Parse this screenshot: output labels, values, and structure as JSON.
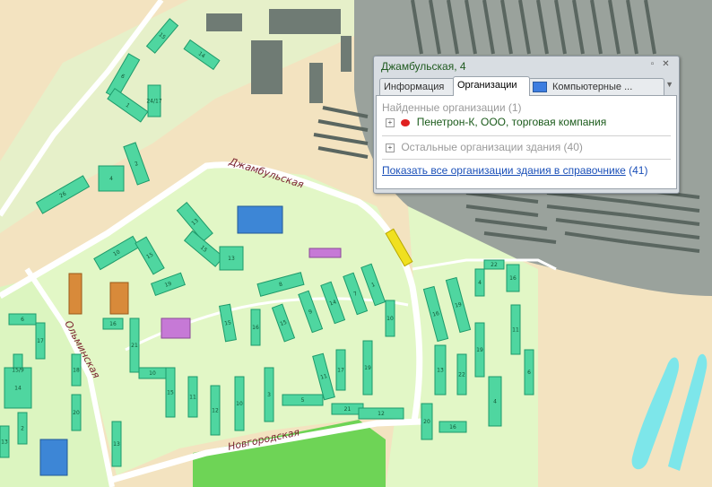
{
  "map": {
    "streets": [
      {
        "id": "dzhambul",
        "label": "Джамбульская"
      },
      {
        "id": "olminskogo",
        "label": "Ольминская"
      },
      {
        "id": "novgorod",
        "label": "Новгородская"
      }
    ],
    "building_numbers": [
      "15",
      "14",
      "6",
      "1",
      "2",
      "26",
      "4",
      "24/17",
      "10",
      "15",
      "13",
      "15",
      "13",
      "19",
      "16",
      "21",
      "10",
      "18",
      "20",
      "13",
      "17",
      "15/9",
      "6",
      "14",
      "2",
      "13",
      "15",
      "11",
      "12",
      "10",
      "3",
      "5",
      "11",
      "17",
      "19",
      "21",
      "12",
      "15",
      "16",
      "15",
      "9",
      "14",
      "7",
      "1",
      "10",
      "8",
      "16",
      "19",
      "13",
      "22",
      "19",
      "4",
      "11",
      "6",
      "16",
      "20",
      "22",
      "16",
      "4",
      "24"
    ]
  },
  "popup": {
    "title": "Джамбульская, 4",
    "tabs": [
      "Информация",
      "Организации",
      "Компьютерные ..."
    ],
    "active_tab": "Организации",
    "found_header": "Найденные организации (1)",
    "found_org": "Пенетрон-К, ООО, торговая компания",
    "other_header": "Остальные организации здания (40)",
    "show_all_link": "Показать все организации здания в справочнике",
    "show_all_count": "(41)"
  },
  "colors": {
    "ground": "#f3e3c0",
    "park": "#d6f2b8",
    "park_dark": "#7ed35c",
    "building": "#4fd6a0",
    "building_side": "#1e9a6a",
    "industrial": "#7f8f7f",
    "highlight": "#f0e020",
    "water": "#7de6ea"
  }
}
